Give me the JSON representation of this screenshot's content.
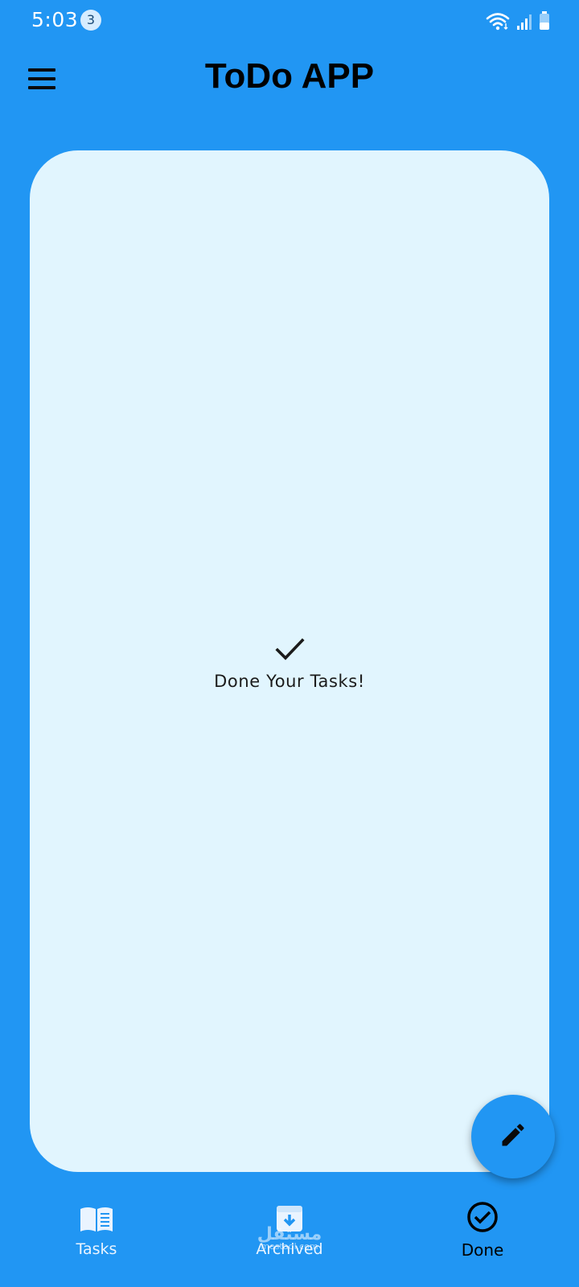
{
  "status_bar": {
    "time": "5:03",
    "notification_count": "3",
    "icons": [
      "wifi-icon",
      "signal-icon",
      "battery-icon"
    ]
  },
  "app_bar": {
    "menu_icon": "hamburger-menu-icon",
    "title": "ToDo APP"
  },
  "content": {
    "empty_state_icon": "check-icon",
    "empty_state_text": "Done Your Tasks!"
  },
  "fab": {
    "icon": "pencil-edit-icon"
  },
  "bottom_nav": {
    "items": [
      {
        "label": "Tasks",
        "icon": "book-icon",
        "active": false
      },
      {
        "label": "Archived",
        "icon": "archive-icon",
        "active": false
      },
      {
        "label": "Done",
        "icon": "check-circle-icon",
        "active": true
      }
    ]
  },
  "watermark": {
    "main": "مستقل",
    "sub": "mostaql.com"
  },
  "colors": {
    "primary": "#2196F3",
    "card_background": "#E1F5FE",
    "title_text": "#000000",
    "inactive_nav": "#EAF4FF",
    "active_nav": "#000000"
  }
}
